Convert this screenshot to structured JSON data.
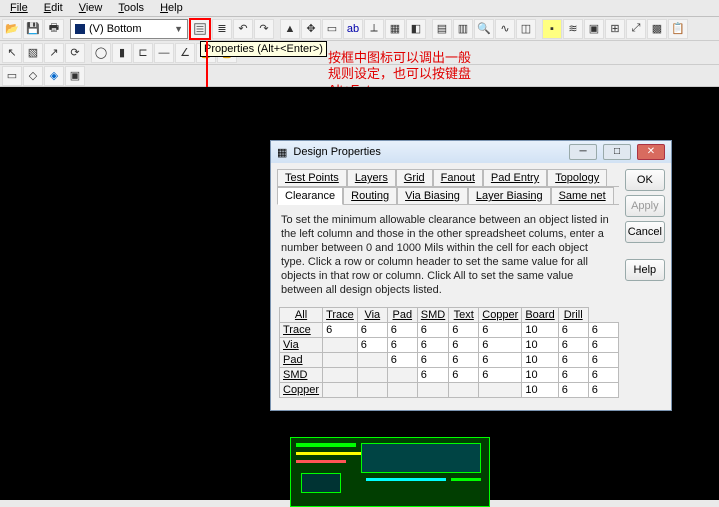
{
  "menu": {
    "file": "File",
    "edit": "Edit",
    "view": "View",
    "tools": "Tools",
    "help": "Help"
  },
  "layer_dropdown": {
    "value": "(V) Bottom"
  },
  "tooltip": {
    "text": "Properties (Alt+<Enter>)"
  },
  "annotation": {
    "line1": "按框中图标可以调出一般",
    "line2": "规则设定，也可以按键盘",
    "line3": "Alt+Enter"
  },
  "dialog": {
    "title": "Design Properties",
    "tabs_row1": [
      "Test Points",
      "Layers",
      "Grid",
      "Fanout",
      "Pad Entry",
      "Topology"
    ],
    "tabs_row2": [
      "Clearance",
      "Routing",
      "Via Biasing",
      "Layer Biasing",
      "Same net"
    ],
    "active_tab": "Clearance",
    "buttons": {
      "ok": "OK",
      "apply": "Apply",
      "cancel": "Cancel",
      "help": "Help"
    },
    "explain": "To set the minimum allowable clearance between an object listed in the left column and those in the other spreadsheet colums, enter a number between 0 and 1000 Mils within the cell for each object type. Click a row or column header to set the same value for all objects in that row or column. Click All to set the same value between all design objects listed.",
    "table": {
      "cols": [
        "All",
        "Trace",
        "Via",
        "Pad",
        "SMD",
        "Text",
        "Copper",
        "Board",
        "Drill"
      ],
      "rows": [
        {
          "name": "Trace",
          "cells": [
            "6",
            "6",
            "6",
            "6",
            "6",
            "6",
            "10",
            "6",
            "6"
          ]
        },
        {
          "name": "Via",
          "cells": [
            "",
            "6",
            "6",
            "6",
            "6",
            "6",
            "10",
            "6",
            "6"
          ]
        },
        {
          "name": "Pad",
          "cells": [
            "",
            "",
            "6",
            "6",
            "6",
            "6",
            "10",
            "6",
            "6"
          ]
        },
        {
          "name": "SMD",
          "cells": [
            "",
            "",
            "",
            "6",
            "6",
            "6",
            "10",
            "6",
            "6"
          ]
        },
        {
          "name": "Copper",
          "cells": [
            "",
            "",
            "",
            "",
            "",
            "",
            "10",
            "6",
            "6"
          ]
        }
      ]
    }
  }
}
